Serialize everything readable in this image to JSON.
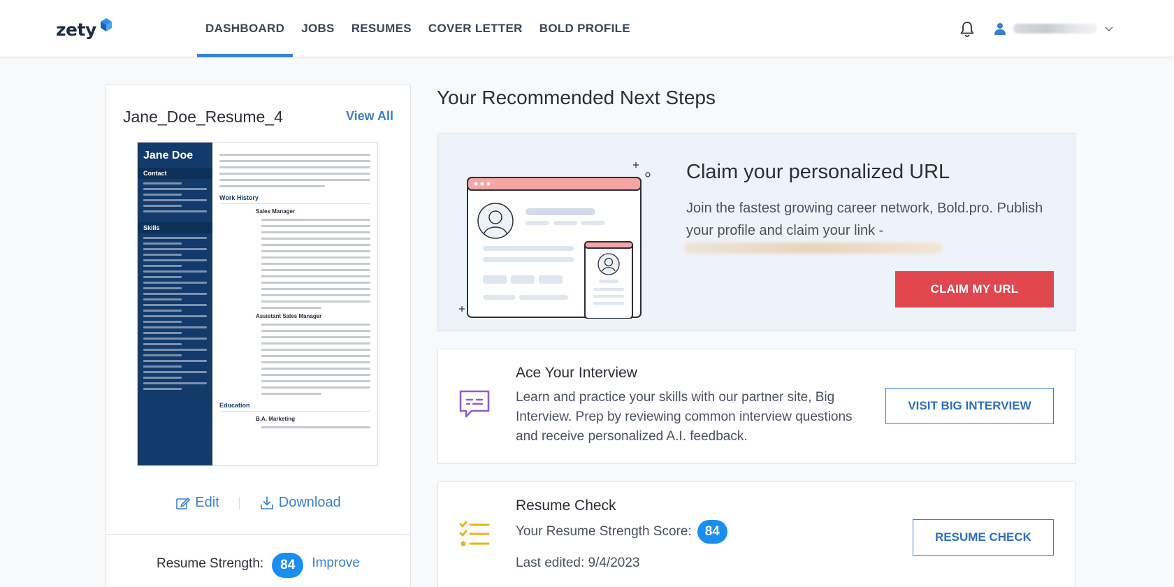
{
  "header": {
    "logo": "zety",
    "nav": [
      "DASHBOARD",
      "JOBS",
      "RESUMES",
      "COVER LETTER",
      "BOLD PROFILE"
    ],
    "active_nav": "DASHBOARD"
  },
  "resume": {
    "title": "Jane_Doe_Resume_4",
    "view_all": "View All",
    "preview": {
      "name": "Jane Doe",
      "contact": "Contact",
      "skills": "Skills",
      "work_history": "Work History",
      "job1": "Sales Manager",
      "job2": "Assistant Sales Manager",
      "education": "Education",
      "degree": "B.A. Marketing"
    },
    "edit": "Edit",
    "download": "Download",
    "strength_label": "Resume Strength:",
    "strength_score": "84",
    "improve": "Improve"
  },
  "next_steps": {
    "title": "Your Recommended Next Steps",
    "url_card": {
      "title": "Claim your personalized URL",
      "text": "Join the fastest growing career network, Bold.pro. Publish your profile and claim your link -",
      "button": "CLAIM MY URL"
    },
    "interview_card": {
      "title": "Ace Your Interview",
      "text": "Learn and practice your skills with our partner site, Big Interview. Prep by reviewing common interview questions and receive personalized A.I. feedback.",
      "button": "VISIT BIG INTERVIEW"
    },
    "check_card": {
      "title": "Resume Check",
      "score_label": "Your Resume Strength Score:",
      "score": "84",
      "last_edited": "Last edited: 9/4/2023",
      "button": "RESUME CHECK"
    }
  },
  "colors": {
    "accent": "#3b7fd0",
    "brand_red": "#e0464e",
    "badge_blue": "#1a8ef0",
    "resume_sidebar": "#123a6b",
    "icon_purple": "#8e5bd8",
    "icon_yellow": "#e8b517"
  },
  "icons": [
    "bell-icon",
    "user-icon",
    "chevron-down-icon",
    "edit-icon",
    "download-icon",
    "chat-icon",
    "checklist-icon"
  ]
}
